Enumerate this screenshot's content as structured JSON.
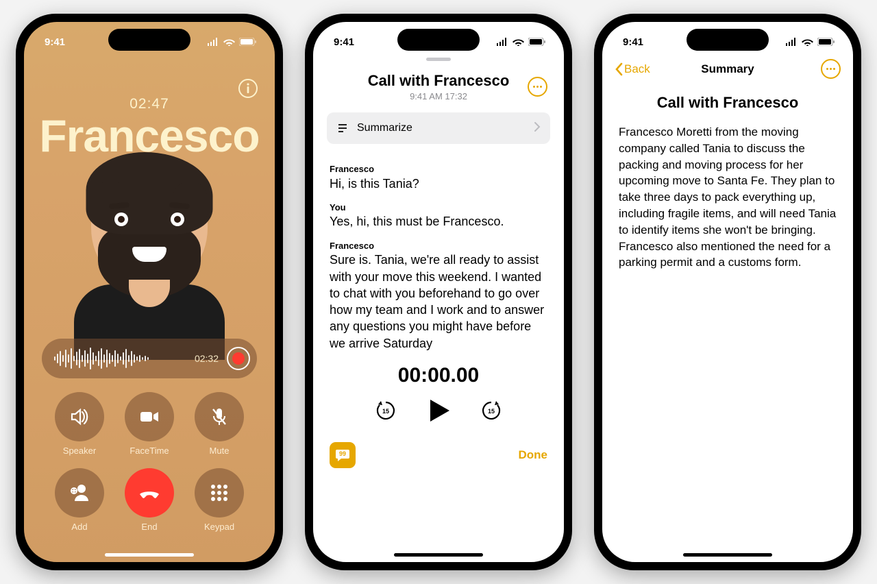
{
  "status": {
    "time": "9:41"
  },
  "phone1": {
    "timer": "02:47",
    "caller": "Francesco",
    "wave_time": "02:32",
    "controls": {
      "speaker": "Speaker",
      "facetime": "FaceTime",
      "mute": "Mute",
      "add": "Add",
      "end": "End",
      "keypad": "Keypad"
    }
  },
  "phone2": {
    "title": "Call with Francesco",
    "subtitle": "9:41 AM   17:32",
    "summarize": "Summarize",
    "transcript": [
      {
        "speaker": "Francesco",
        "text": "Hi, is this Tania?"
      },
      {
        "speaker": "You",
        "text": "Yes, hi, this must be Francesco."
      },
      {
        "speaker": "Francesco",
        "text": "Sure is. Tania, we're all ready to assist with your move this weekend. I wanted to chat with you beforehand to go over how my team and I work and to answer any questions you might have before we arrive Saturday"
      }
    ],
    "play_time": "00:00.00",
    "done": "Done"
  },
  "phone3": {
    "back": "Back",
    "nav_title": "Summary",
    "title": "Call with Francesco",
    "body": "Francesco Moretti from the moving company called Tania to discuss the packing and moving process for her upcoming move to Santa Fe. They plan to take three days to pack everything up, including fragile items, and will need Tania to identify items she won't be bringing. Francesco also mentioned the need for a parking permit and a customs form."
  }
}
